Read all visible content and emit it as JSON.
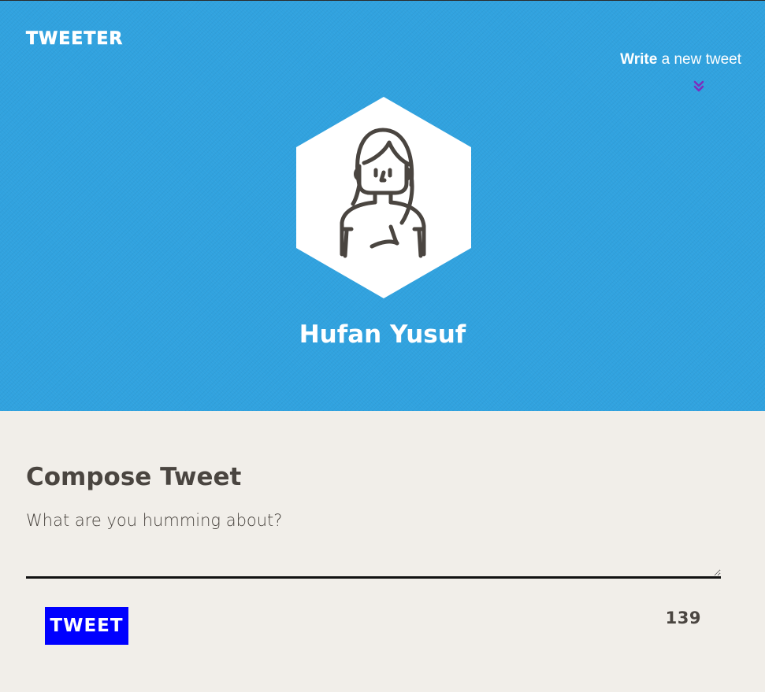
{
  "header": {
    "brand": "TWEETER",
    "write_link_bold": "Write",
    "write_link_rest": " a new tweet",
    "user_name": "Hufan Yusuf",
    "background_color": "#30a2df",
    "chevron_icon": "double-chevron-down-icon",
    "chevron_color": "#7b2fbe"
  },
  "compose": {
    "title": "Compose Tweet",
    "placeholder": "What are you humming about?",
    "tweet_button_label": "TWEET",
    "tweet_button_color": "#0000ff",
    "char_count": "139"
  },
  "avatar": {
    "icon": "user-avatar-icon",
    "shape": "hexagon"
  }
}
